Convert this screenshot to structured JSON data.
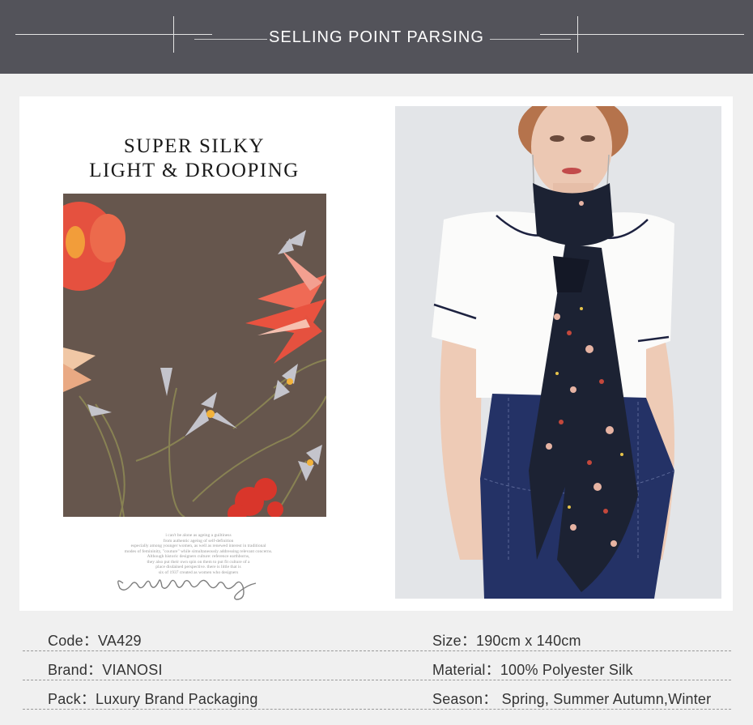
{
  "header": {
    "title": "SELLING POINT PARSING"
  },
  "feature": {
    "headline_line1": "SUPER SILKY",
    "headline_line2": "LIGHT & DROOPING",
    "fineprint": [
      "i can't be alone as ageing a guiltiness",
      "from authentic ageing of self-definition",
      "especially among younger women, as well as renewed interest in traditional",
      "modes of femininity, \"couture\" while simultaneously addressing relevant concerns.",
      "Although historic designers culture: reference earthborns,",
      "they also put their own spin on them to put fit culture of a",
      "place disdained perspective. there is little that is",
      "six of 1937 created as women who designers"
    ],
    "signature": "Couture enjoy"
  },
  "colors": {
    "banner": "#53535a",
    "page": "#f0f0f0",
    "fabric_base": "#6b5a50",
    "flower_red": "#e5513f",
    "scarf_navy": "#1c2233",
    "skirt_navy": "#243266"
  },
  "specs": {
    "code": "Code：VA429",
    "size": "Size：190cm x 140cm",
    "brand": "Brand：VIANOSI",
    "material": "Material：100% Polyester Silk",
    "pack": "Pack：Luxury Brand Packaging",
    "season": "Season： Spring, Summer Autumn,Winter"
  }
}
